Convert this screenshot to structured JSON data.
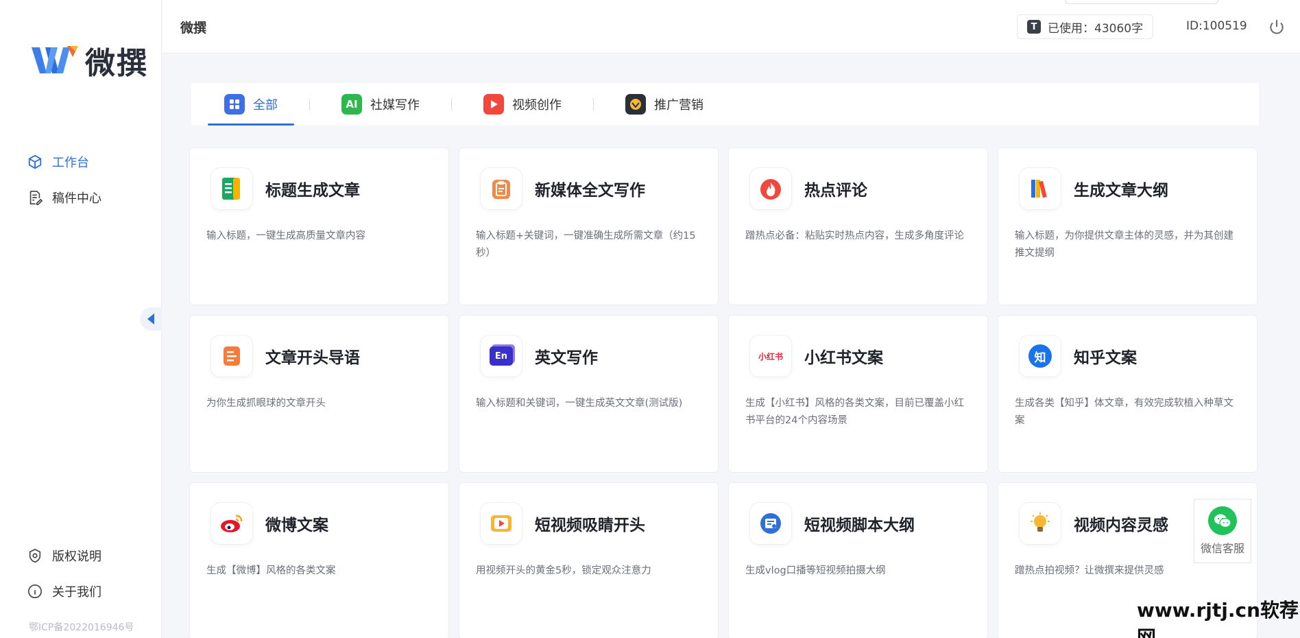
{
  "app": {
    "name": "微撰",
    "header_title": "微撰"
  },
  "header": {
    "usage_label": "已使用：43060字",
    "usage_icon": "T",
    "user_id": "ID:100519"
  },
  "sidebar": {
    "items": [
      {
        "label": "工作台",
        "icon": "cube-icon"
      },
      {
        "label": "稿件中心",
        "icon": "document-edit-icon"
      }
    ],
    "bottom_items": [
      {
        "label": "版权说明",
        "icon": "shield-icon"
      },
      {
        "label": "关于我们",
        "icon": "info-icon"
      }
    ],
    "icp": "鄂ICP备2022016946号"
  },
  "tabs": [
    {
      "label": "全部",
      "icon": "grid-icon",
      "color": "#3d6fe8"
    },
    {
      "label": "社媒写作",
      "icon": "ai-icon",
      "icon_text": "AI",
      "color": "#2db84d"
    },
    {
      "label": "视频创作",
      "icon": "play-icon",
      "color": "#f0483d"
    },
    {
      "label": "推广营销",
      "icon": "badge-icon",
      "color": "#2b2f3a"
    }
  ],
  "cards": [
    {
      "title": "标题生成文章",
      "desc": "输入标题，一键生成高质量文章内容",
      "icon": "green-document-icon"
    },
    {
      "title": "新媒体全文写作",
      "desc": "输入标题+关键词，一键准确生成所需文章（约15秒）",
      "icon": "clipboard-icon"
    },
    {
      "title": "热点评论",
      "desc": "蹭热点必备：粘贴实时热点内容，生成多角度评论",
      "icon": "flame-icon"
    },
    {
      "title": "生成文章大纲",
      "desc": "输入标题，为你提供文章主体的灵感，并为其创建推文提纲",
      "icon": "books-icon"
    },
    {
      "title": "文章开头导语",
      "desc": "为你生成抓眼球的文章开头",
      "icon": "orange-document-icon"
    },
    {
      "title": "英文写作",
      "desc": "输入标题和关键词，一键生成英文文章(测试版)",
      "icon": "english-icon",
      "icon_text": "En"
    },
    {
      "title": "小红书文案",
      "desc": "生成【小红书】风格的各类文案，目前已覆盖小红书平台的24个内容场景",
      "icon": "xiaohongshu-icon",
      "icon_text": "小红书"
    },
    {
      "title": "知乎文案",
      "desc": "生成各类【知乎】体文章，有效完成软植入种草文案",
      "icon": "zhihu-icon",
      "icon_text": "知"
    },
    {
      "title": "微博文案",
      "desc": "生成【微博】风格的各类文案",
      "icon": "weibo-icon"
    },
    {
      "title": "短视频吸睛开头",
      "desc": "用视频开头的黄金5秒，锁定观众注意力",
      "icon": "video-play-icon"
    },
    {
      "title": "短视频脚本大纲",
      "desc": "生成vlog口播等短视频拍摄大纲",
      "icon": "video-script-icon"
    },
    {
      "title": "视频内容灵感",
      "desc": "蹭热点拍视频？让微撰来提供灵感",
      "icon": "lightbulb-icon"
    }
  ],
  "service": {
    "label": "微信客服"
  },
  "watermark": "www.rjtj.cn软荐网"
}
